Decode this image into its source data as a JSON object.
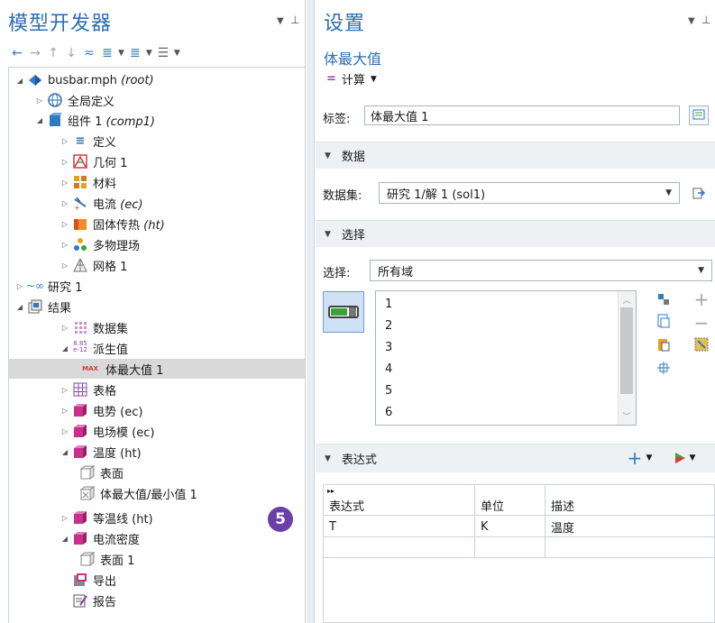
{
  "left_panel": {
    "title": "模型开发器",
    "tree": [
      {
        "label": "busbar.mph",
        "tag": "(root)",
        "icon": "model-root-icon"
      },
      {
        "label": "全局定义",
        "tag": "",
        "icon": "globe-icon"
      },
      {
        "label": "组件 1",
        "tag": "(comp1)",
        "icon": "component-icon"
      },
      {
        "label": "定义",
        "tag": "",
        "icon": "definitions-icon"
      },
      {
        "label": "几何 1",
        "tag": "",
        "icon": "geometry-icon"
      },
      {
        "label": "材料",
        "tag": "",
        "icon": "materials-icon"
      },
      {
        "label": "电流",
        "tag": "(ec)",
        "icon": "electric-currents-icon"
      },
      {
        "label": "固体传热",
        "tag": "(ht)",
        "icon": "heat-transfer-icon"
      },
      {
        "label": "多物理场",
        "tag": "",
        "icon": "multiphysics-icon"
      },
      {
        "label": "网格 1",
        "tag": "",
        "icon": "mesh-icon"
      },
      {
        "label": "研究 1",
        "tag": "",
        "icon": "study-icon"
      },
      {
        "label": "结果",
        "tag": "",
        "icon": "results-icon"
      },
      {
        "label": "数据集",
        "tag": "",
        "icon": "datasets-icon"
      },
      {
        "label": "派生值",
        "tag": "",
        "icon": "derived-values-icon"
      },
      {
        "label": "体最大值 1",
        "tag": "",
        "icon": "volume-maximum-icon"
      },
      {
        "label": "表格",
        "tag": "",
        "icon": "table-icon"
      },
      {
        "label": "电势 (ec)",
        "tag": "",
        "icon": "plot-group-icon"
      },
      {
        "label": "电场模 (ec)",
        "tag": "",
        "icon": "plot-group-icon"
      },
      {
        "label": "温度 (ht)",
        "tag": "",
        "icon": "plot-group-icon"
      },
      {
        "label": "表面",
        "tag": "",
        "icon": "surface-plot-icon"
      },
      {
        "label": "体最大值/最小值 1",
        "tag": "",
        "icon": "max-min-volume-icon"
      },
      {
        "label": "等温线 (ht)",
        "tag": "",
        "icon": "plot-group-icon"
      },
      {
        "label": "电流密度",
        "tag": "",
        "icon": "plot-group-icon"
      },
      {
        "label": "表面 1",
        "tag": "",
        "icon": "surface-plot-icon"
      },
      {
        "label": "导出",
        "tag": "",
        "icon": "export-icon"
      },
      {
        "label": "报告",
        "tag": "",
        "icon": "report-icon"
      }
    ],
    "badge": "5",
    "derived_icon_text": "8.85\ne-12",
    "max_icon_text": "MAX"
  },
  "settings": {
    "title": "设置",
    "subtitle": "体最大值",
    "compute_label": "计算",
    "label_field": {
      "label": "标签:",
      "value": "体最大值 1"
    },
    "data_section": {
      "title": "数据",
      "dataset_label": "数据集:",
      "dataset_value": "研究 1/解 1 (sol1)"
    },
    "selection_section": {
      "title": "选择",
      "selection_label": "选择:",
      "selection_value": "所有域",
      "items": [
        "1",
        "2",
        "3",
        "4",
        "5",
        "6"
      ]
    },
    "expression_section": {
      "title": "表达式",
      "columns": [
        "表达式",
        "单位",
        "描述"
      ],
      "rows": [
        {
          "expr": "T",
          "unit": "K",
          "desc": "温度"
        }
      ]
    }
  },
  "colors": {
    "accent": "#2b6fb4",
    "badge": "#6b3fa8",
    "selection": "#d9d9d9"
  }
}
